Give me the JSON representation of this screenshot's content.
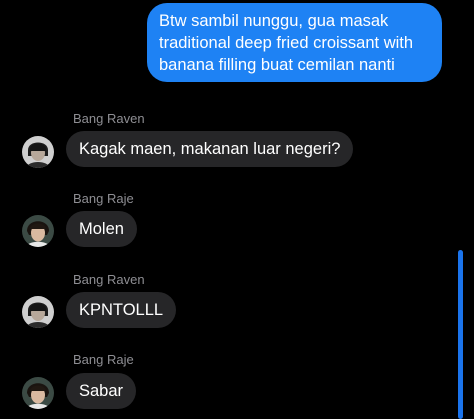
{
  "outgoing": {
    "lines": [
      "Btw sambil nunggu, gua masak",
      "traditional deep fried croissant with",
      "banana filling buat cemilan nanti"
    ]
  },
  "messages": [
    {
      "sender": "Bang Raven",
      "text": "Kagak maen, makanan luar negeri?"
    },
    {
      "sender": "Bang Raje",
      "text": "Molen"
    },
    {
      "sender": "Bang Raven",
      "text": "KPNTOLLL"
    },
    {
      "sender": "Bang Raje",
      "text": "Sabar"
    }
  ],
  "colors": {
    "background": "#000000",
    "outgoing_bubble": "#1e82f4",
    "incoming_bubble": "#262628",
    "sender_name": "#8e8e93",
    "scrollbar": "#1b74ec"
  }
}
